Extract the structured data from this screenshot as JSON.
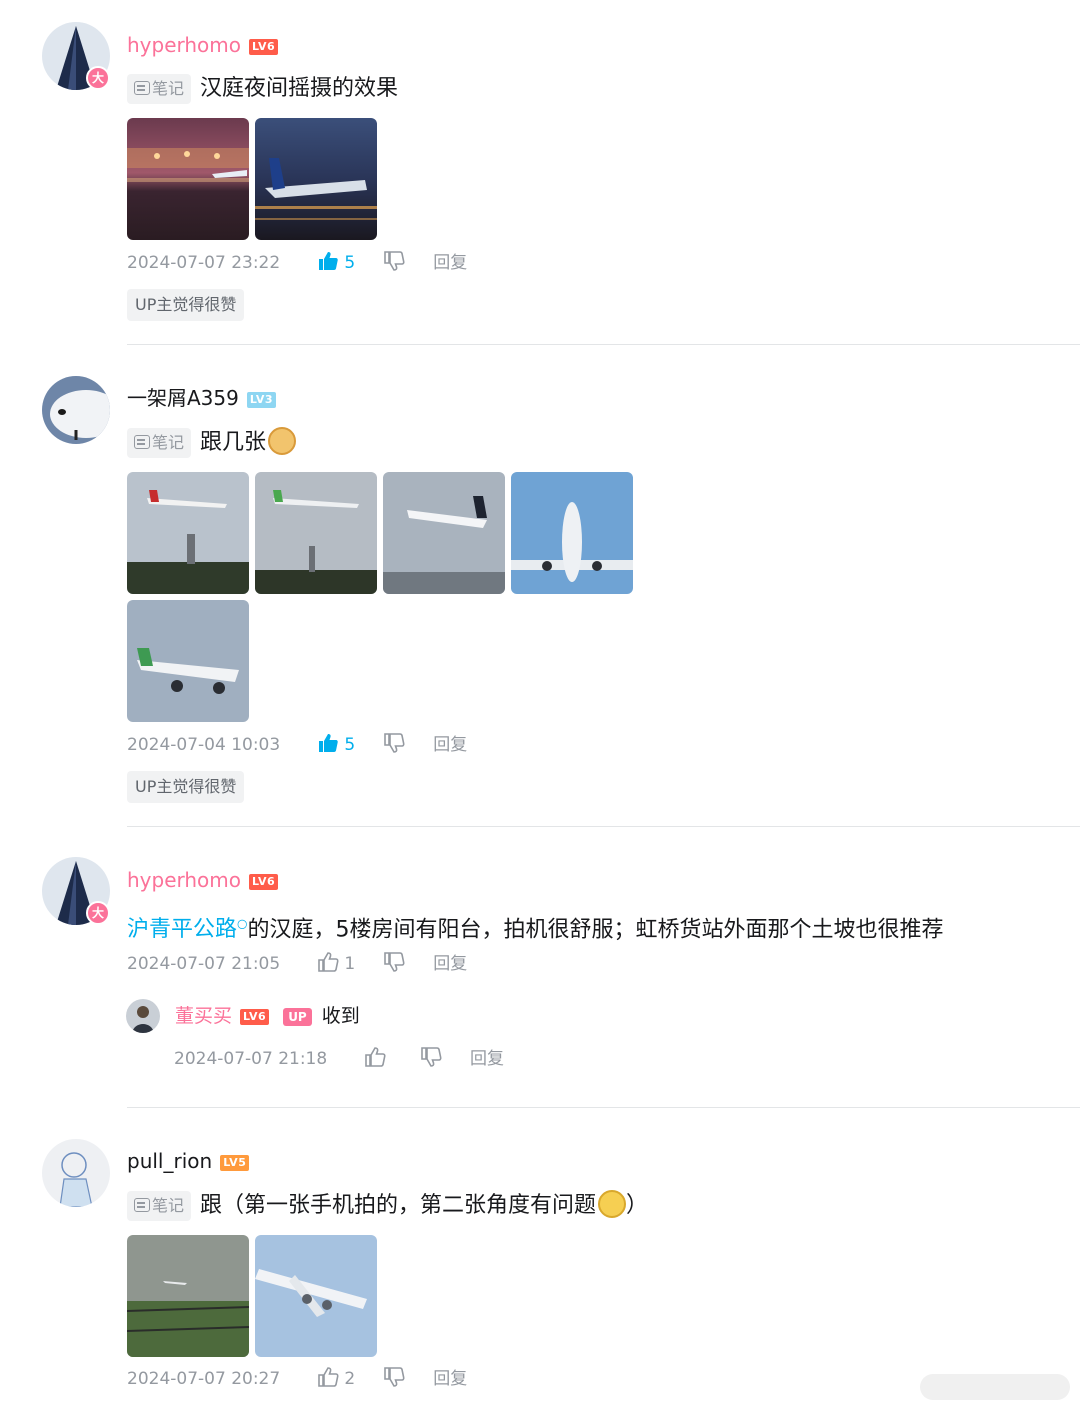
{
  "comments": [
    {
      "username": "hyperhomo",
      "level": "LV6",
      "avatar_badge": "大",
      "note_tag": "笔记",
      "text": "汉庭夜间摇摄的效果",
      "time": "2024-07-07 23:22",
      "likes": "5",
      "reply": "回复",
      "up_liked": "UP主觉得很赞",
      "images": [
        "night-airport-terminal-photo",
        "night-taxiing-airliner-photo"
      ]
    },
    {
      "username": "一架屑A359",
      "level": "LV3",
      "note_tag": "笔记",
      "text": "跟几张",
      "time": "2024-07-04 10:03",
      "likes": "5",
      "reply": "回复",
      "up_liked": "UP主觉得很赞",
      "images": [
        "shanghai-airlines-approach-photo",
        "spring-airlines-approach-photo",
        "star-alliance-approach-photo",
        "a350-underside-photo",
        "green-tail-airliner-photo"
      ]
    },
    {
      "username": "hyperhomo",
      "level": "LV6",
      "avatar_badge": "大",
      "topic_link": "沪青平公路",
      "text": "的汉庭，5楼房间有阳台，拍机很舒服；虹桥货站外面那个土坡也很推荐",
      "time": "2024-07-07 21:05",
      "likes": "1",
      "reply": "回复",
      "sub_reply": {
        "username": "董买买",
        "level": "LV6",
        "up_badge": "UP",
        "text": "收到",
        "time": "2024-07-07 21:18",
        "reply": "回复"
      }
    },
    {
      "username": "pull_rion",
      "level": "LV5",
      "note_tag": "笔记",
      "text": "跟（第一张手机拍的，第二张角度有问题",
      "text_end": "）",
      "time": "2024-07-07 20:27",
      "likes": "2",
      "reply": "回复",
      "images": [
        "rainy-runway-photo",
        "a380-underside-photo"
      ]
    }
  ],
  "colors": {
    "accent_pink": "#fb7299",
    "link_blue": "#00aeec",
    "meta_gray": "#9499a0"
  }
}
